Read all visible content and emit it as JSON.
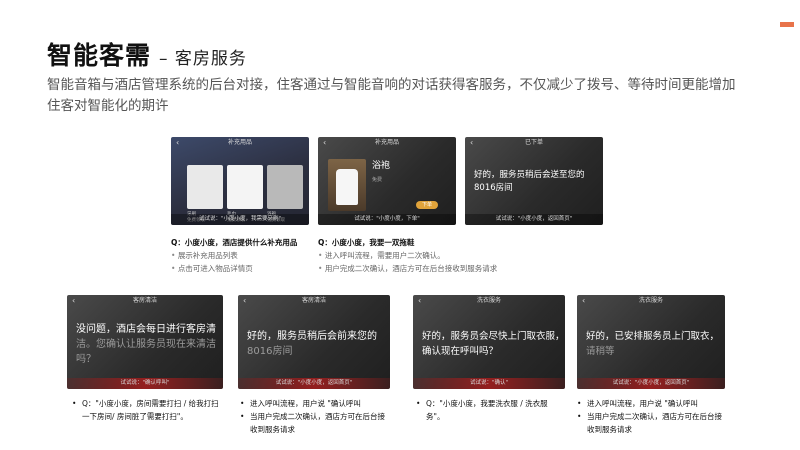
{
  "title": "智能客需",
  "subtitle": "– 客房服务",
  "intro": "智能音箱与酒店管理系统的后台对接，住客通过与智能音响的对话获得客服务，不仅减少了拨号、等待时间更能增加住客对智能化的期许",
  "top_row": [
    {
      "header": "补充用品",
      "products": [
        {
          "name": "牙刷",
          "note": "免费领取"
        },
        {
          "name": "毛巾",
          "note": "免费领取"
        },
        {
          "name": "浴袍",
          "note": "免费领取"
        }
      ],
      "footer": "试试说：\"小度小度，我需要牙刷\"",
      "question": "Q：小度小度，酒店提供什么补充用品",
      "bullets": [
        "展示补充用品列表",
        "点击可进入物品详情页"
      ]
    },
    {
      "header": "补充用品",
      "item_name": "浴袍",
      "item_note": "免费",
      "button": "下单",
      "footer": "试试说：\"小度小度，下单\"",
      "question": "Q：小度小度，我要一双拖鞋",
      "bullets": [
        "进入呼叫流程，需要用户二次确认。",
        "用户完成二次确认，酒店方可在后台接收到服务请求"
      ]
    },
    {
      "header": "已下单",
      "message": "好的，服务员稍后会送至您的",
      "room": "8016房间",
      "footer": "试试说：\"小度小度，返回首页\""
    }
  ],
  "bottom_row": [
    {
      "header": "客房清洁",
      "line1": "没问题，酒店会每日进行客房清",
      "line2": "洁。您确认让服务员现在来清洁",
      "line3": "吗？",
      "footer": "试试说：\"确认呼叫\"",
      "bullets": [
        "Q：\"小度小度，房间需要打扫 / 给我打扫一下房间/ 房间脏了需要打扫\"。"
      ]
    },
    {
      "header": "客房清洁",
      "line1": "好的，服务员稍后会前来您的",
      "line2": "8016房间",
      "footer": "试试说：\"小度小度，返回首页\"",
      "bullets": [
        "进入呼叫流程，用户说 \"确认呼叫",
        "当用户完成二次确认，酒店方可在后台接收到服务请求"
      ]
    },
    {
      "header": "洗衣服务",
      "line1": "好的，服务员会尽快上门取衣服，",
      "line2": "确认现在呼叫吗？",
      "footer": "试试说：\"确认\"",
      "bullets": [
        "Q：\"小度小度，我要洗衣服 / 洗衣服务\"。"
      ]
    },
    {
      "header": "洗衣服务",
      "line1": "好的，已安排服务员上门取衣，",
      "line2": "请稍等",
      "footer": "试试说：\"小度小度，返回首页\"",
      "bullets": [
        "进入呼叫流程，用户说 \"确认呼叫",
        "当用户完成二次确认，酒店方可在后台接收到服务请求"
      ]
    }
  ]
}
